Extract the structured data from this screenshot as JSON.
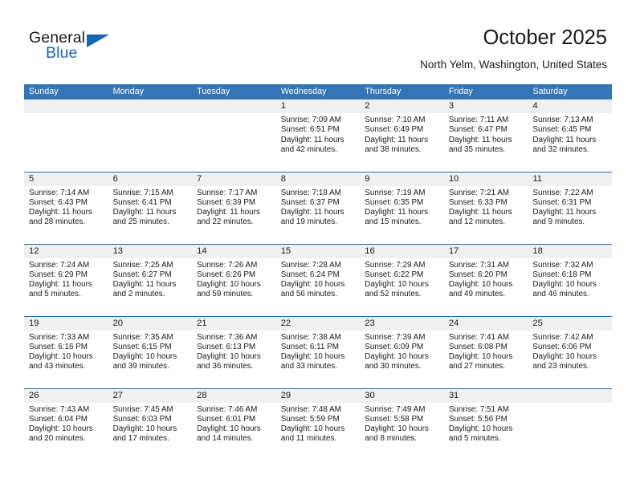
{
  "brand": {
    "name_part1": "General",
    "name_part2": "Blue",
    "accent_color": "#1565b0"
  },
  "header": {
    "title": "October 2025",
    "subtitle": "North Yelm, Washington, United States"
  },
  "theme": {
    "header_bar_color": "#3375b5",
    "row_divider_color": "#2b6aa8",
    "daynum_bar_color": "#f0f0f0"
  },
  "weekdays": [
    "Sunday",
    "Monday",
    "Tuesday",
    "Wednesday",
    "Thursday",
    "Friday",
    "Saturday"
  ],
  "weeks": [
    [
      {
        "day": "",
        "sunrise": "",
        "sunset": "",
        "daylight1": "",
        "daylight2": ""
      },
      {
        "day": "",
        "sunrise": "",
        "sunset": "",
        "daylight1": "",
        "daylight2": ""
      },
      {
        "day": "",
        "sunrise": "",
        "sunset": "",
        "daylight1": "",
        "daylight2": ""
      },
      {
        "day": "1",
        "sunrise": "Sunrise: 7:09 AM",
        "sunset": "Sunset: 6:51 PM",
        "daylight1": "Daylight: 11 hours",
        "daylight2": "and 42 minutes."
      },
      {
        "day": "2",
        "sunrise": "Sunrise: 7:10 AM",
        "sunset": "Sunset: 6:49 PM",
        "daylight1": "Daylight: 11 hours",
        "daylight2": "and 38 minutes."
      },
      {
        "day": "3",
        "sunrise": "Sunrise: 7:11 AM",
        "sunset": "Sunset: 6:47 PM",
        "daylight1": "Daylight: 11 hours",
        "daylight2": "and 35 minutes."
      },
      {
        "day": "4",
        "sunrise": "Sunrise: 7:13 AM",
        "sunset": "Sunset: 6:45 PM",
        "daylight1": "Daylight: 11 hours",
        "daylight2": "and 32 minutes."
      }
    ],
    [
      {
        "day": "5",
        "sunrise": "Sunrise: 7:14 AM",
        "sunset": "Sunset: 6:43 PM",
        "daylight1": "Daylight: 11 hours",
        "daylight2": "and 28 minutes."
      },
      {
        "day": "6",
        "sunrise": "Sunrise: 7:15 AM",
        "sunset": "Sunset: 6:41 PM",
        "daylight1": "Daylight: 11 hours",
        "daylight2": "and 25 minutes."
      },
      {
        "day": "7",
        "sunrise": "Sunrise: 7:17 AM",
        "sunset": "Sunset: 6:39 PM",
        "daylight1": "Daylight: 11 hours",
        "daylight2": "and 22 minutes."
      },
      {
        "day": "8",
        "sunrise": "Sunrise: 7:18 AM",
        "sunset": "Sunset: 6:37 PM",
        "daylight1": "Daylight: 11 hours",
        "daylight2": "and 19 minutes."
      },
      {
        "day": "9",
        "sunrise": "Sunrise: 7:19 AM",
        "sunset": "Sunset: 6:35 PM",
        "daylight1": "Daylight: 11 hours",
        "daylight2": "and 15 minutes."
      },
      {
        "day": "10",
        "sunrise": "Sunrise: 7:21 AM",
        "sunset": "Sunset: 6:33 PM",
        "daylight1": "Daylight: 11 hours",
        "daylight2": "and 12 minutes."
      },
      {
        "day": "11",
        "sunrise": "Sunrise: 7:22 AM",
        "sunset": "Sunset: 6:31 PM",
        "daylight1": "Daylight: 11 hours",
        "daylight2": "and 9 minutes."
      }
    ],
    [
      {
        "day": "12",
        "sunrise": "Sunrise: 7:24 AM",
        "sunset": "Sunset: 6:29 PM",
        "daylight1": "Daylight: 11 hours",
        "daylight2": "and 5 minutes."
      },
      {
        "day": "13",
        "sunrise": "Sunrise: 7:25 AM",
        "sunset": "Sunset: 6:27 PM",
        "daylight1": "Daylight: 11 hours",
        "daylight2": "and 2 minutes."
      },
      {
        "day": "14",
        "sunrise": "Sunrise: 7:26 AM",
        "sunset": "Sunset: 6:26 PM",
        "daylight1": "Daylight: 10 hours",
        "daylight2": "and 59 minutes."
      },
      {
        "day": "15",
        "sunrise": "Sunrise: 7:28 AM",
        "sunset": "Sunset: 6:24 PM",
        "daylight1": "Daylight: 10 hours",
        "daylight2": "and 56 minutes."
      },
      {
        "day": "16",
        "sunrise": "Sunrise: 7:29 AM",
        "sunset": "Sunset: 6:22 PM",
        "daylight1": "Daylight: 10 hours",
        "daylight2": "and 52 minutes."
      },
      {
        "day": "17",
        "sunrise": "Sunrise: 7:31 AM",
        "sunset": "Sunset: 6:20 PM",
        "daylight1": "Daylight: 10 hours",
        "daylight2": "and 49 minutes."
      },
      {
        "day": "18",
        "sunrise": "Sunrise: 7:32 AM",
        "sunset": "Sunset: 6:18 PM",
        "daylight1": "Daylight: 10 hours",
        "daylight2": "and 46 minutes."
      }
    ],
    [
      {
        "day": "19",
        "sunrise": "Sunrise: 7:33 AM",
        "sunset": "Sunset: 6:16 PM",
        "daylight1": "Daylight: 10 hours",
        "daylight2": "and 43 minutes."
      },
      {
        "day": "20",
        "sunrise": "Sunrise: 7:35 AM",
        "sunset": "Sunset: 6:15 PM",
        "daylight1": "Daylight: 10 hours",
        "daylight2": "and 39 minutes."
      },
      {
        "day": "21",
        "sunrise": "Sunrise: 7:36 AM",
        "sunset": "Sunset: 6:13 PM",
        "daylight1": "Daylight: 10 hours",
        "daylight2": "and 36 minutes."
      },
      {
        "day": "22",
        "sunrise": "Sunrise: 7:38 AM",
        "sunset": "Sunset: 6:11 PM",
        "daylight1": "Daylight: 10 hours",
        "daylight2": "and 33 minutes."
      },
      {
        "day": "23",
        "sunrise": "Sunrise: 7:39 AM",
        "sunset": "Sunset: 6:09 PM",
        "daylight1": "Daylight: 10 hours",
        "daylight2": "and 30 minutes."
      },
      {
        "day": "24",
        "sunrise": "Sunrise: 7:41 AM",
        "sunset": "Sunset: 6:08 PM",
        "daylight1": "Daylight: 10 hours",
        "daylight2": "and 27 minutes."
      },
      {
        "day": "25",
        "sunrise": "Sunrise: 7:42 AM",
        "sunset": "Sunset: 6:06 PM",
        "daylight1": "Daylight: 10 hours",
        "daylight2": "and 23 minutes."
      }
    ],
    [
      {
        "day": "26",
        "sunrise": "Sunrise: 7:43 AM",
        "sunset": "Sunset: 6:04 PM",
        "daylight1": "Daylight: 10 hours",
        "daylight2": "and 20 minutes."
      },
      {
        "day": "27",
        "sunrise": "Sunrise: 7:45 AM",
        "sunset": "Sunset: 6:03 PM",
        "daylight1": "Daylight: 10 hours",
        "daylight2": "and 17 minutes."
      },
      {
        "day": "28",
        "sunrise": "Sunrise: 7:46 AM",
        "sunset": "Sunset: 6:01 PM",
        "daylight1": "Daylight: 10 hours",
        "daylight2": "and 14 minutes."
      },
      {
        "day": "29",
        "sunrise": "Sunrise: 7:48 AM",
        "sunset": "Sunset: 5:59 PM",
        "daylight1": "Daylight: 10 hours",
        "daylight2": "and 11 minutes."
      },
      {
        "day": "30",
        "sunrise": "Sunrise: 7:49 AM",
        "sunset": "Sunset: 5:58 PM",
        "daylight1": "Daylight: 10 hours",
        "daylight2": "and 8 minutes."
      },
      {
        "day": "31",
        "sunrise": "Sunrise: 7:51 AM",
        "sunset": "Sunset: 5:56 PM",
        "daylight1": "Daylight: 10 hours",
        "daylight2": "and 5 minutes."
      },
      {
        "day": "",
        "sunrise": "",
        "sunset": "",
        "daylight1": "",
        "daylight2": ""
      }
    ]
  ]
}
